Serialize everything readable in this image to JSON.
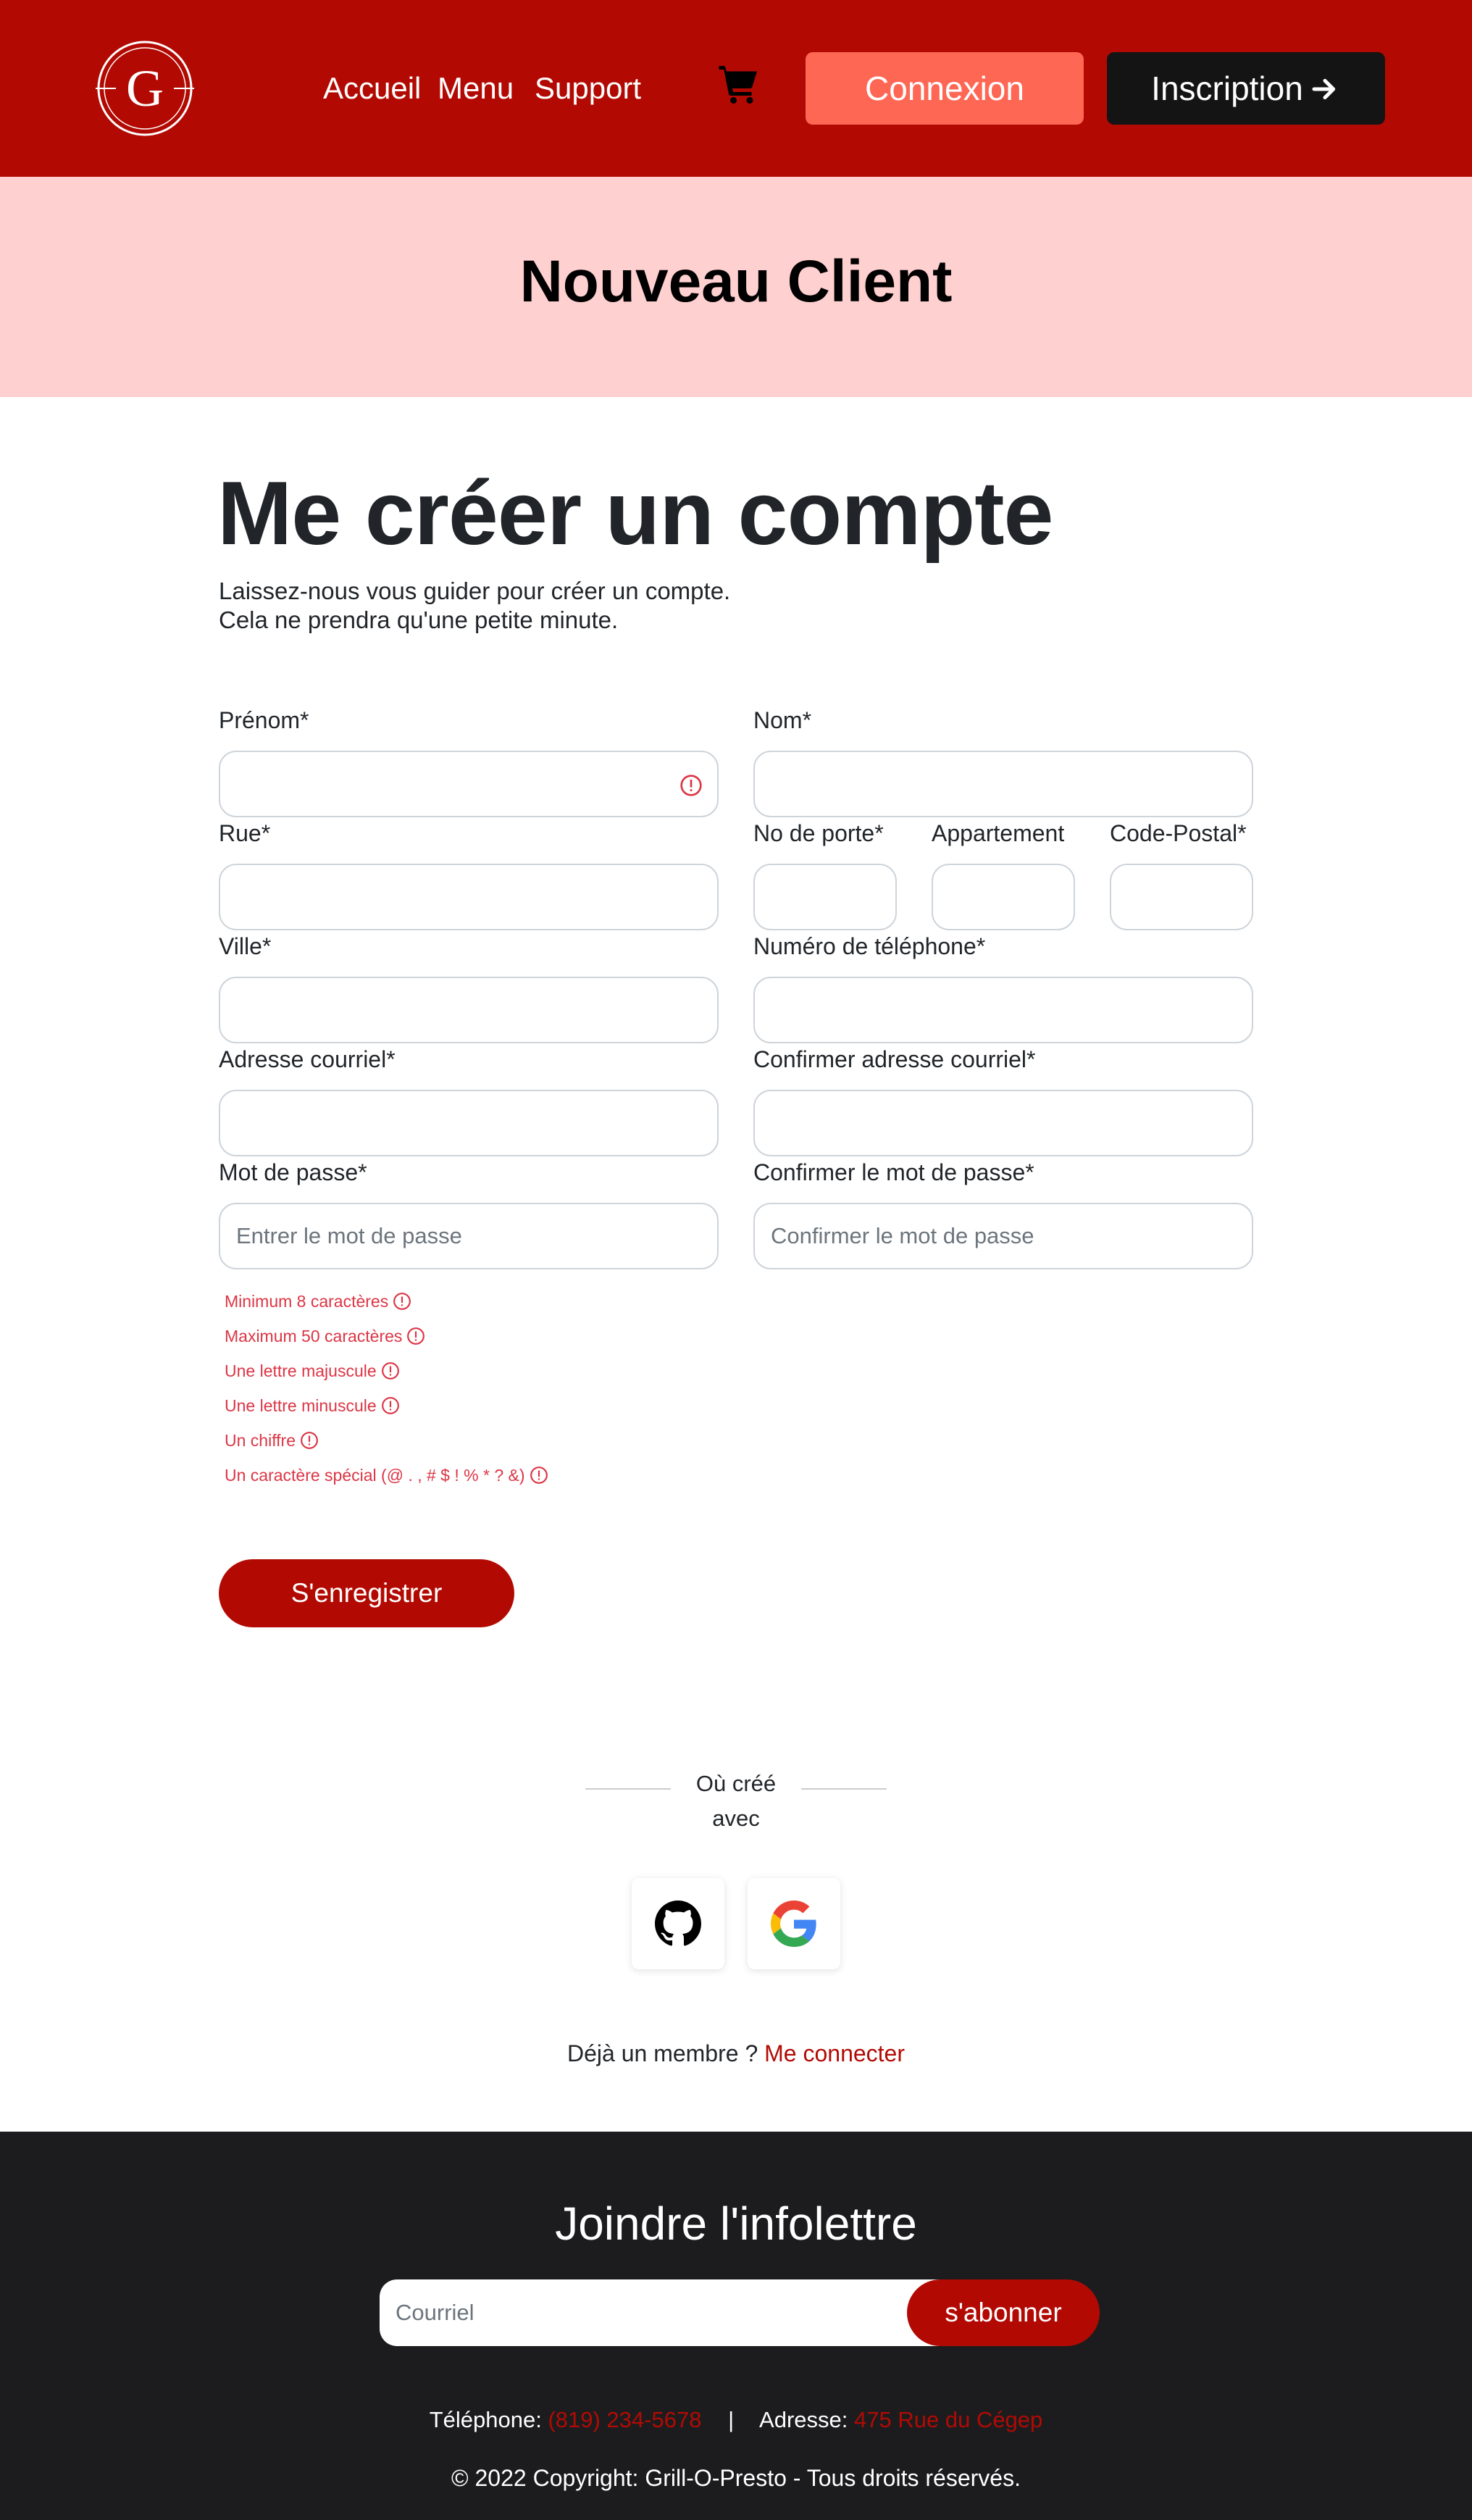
{
  "header": {
    "logo_letter": "G",
    "nav": [
      "Accueil",
      "Menu",
      "Support"
    ],
    "login_label": "Connexion",
    "signup_label": "Inscription",
    "colors": {
      "brand": "#b20a03",
      "login": "#ff6755",
      "signup": "#141414"
    }
  },
  "banner": {
    "title": "Nouveau Client",
    "bg": "#ffd0d0"
  },
  "form": {
    "title": "Me créer un compte",
    "subtitle_line1": "Laissez-nous vous guider pour créer un compte.",
    "subtitle_line2": "Cela ne prendra qu'une petite minute.",
    "labels": {
      "prenom": "Prénom*",
      "nom": "Nom*",
      "rue": "Rue*",
      "no_porte": "No de porte*",
      "appartement": "Appartement",
      "code_postal": "Code-Postal*",
      "ville": "Ville*",
      "telephone": "Numéro de téléphone*",
      "courriel": "Adresse courriel*",
      "confirmer_courriel": "Confirmer adresse courriel*",
      "mot_de_passe": "Mot de passe*",
      "confirmer_mot_de_passe": "Confirmer le mot de passe*"
    },
    "placeholders": {
      "mot_de_passe": "Entrer le mot de passe",
      "confirmer_mot_de_passe": "Confirmer le mot de passe"
    },
    "password_rules": [
      "Minimum 8 caractères",
      "Maximum 50 caractères",
      "Une lettre majuscule",
      "Une lettre minuscule",
      "Un chiffre",
      "Un caractère spécial (@ . , # $ ! % * ? &)"
    ],
    "submit_label": "S'enregistrer"
  },
  "social": {
    "divider_line1": "Où créé",
    "divider_line2": "avec",
    "providers": [
      "github-icon",
      "google-icon"
    ]
  },
  "member": {
    "prompt": "Déjà un membre ?",
    "link": "Me connecter"
  },
  "footer": {
    "title": "Joindre l'infolettre",
    "email_placeholder": "Courriel",
    "subscribe_label": "s'abonner",
    "phone_label": "Téléphone:",
    "phone_value": "(819) 234-5678",
    "separator": "|",
    "address_label": "Adresse:",
    "address_value": "475 Rue du Cégep",
    "copyright": "© 2022 Copyright: Grill-O-Presto - Tous droits réservés."
  }
}
